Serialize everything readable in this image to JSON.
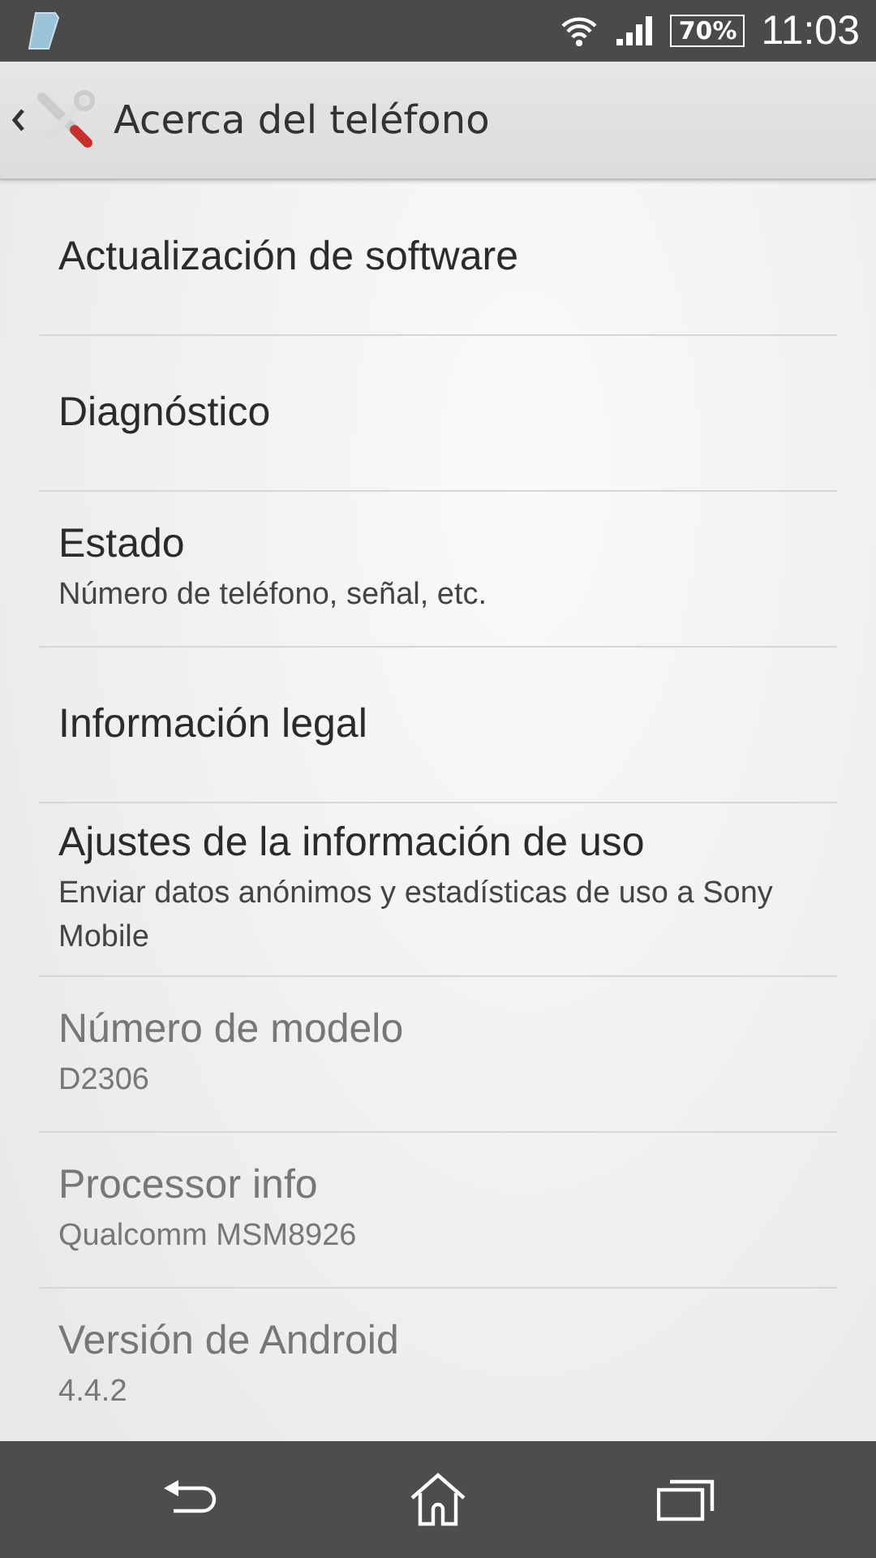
{
  "status_bar": {
    "battery": "70%",
    "time": "11:03"
  },
  "header": {
    "title": "Acerca del teléfono"
  },
  "items": [
    {
      "title": "Actualización de software",
      "disabled": false
    },
    {
      "title": "Diagnóstico",
      "disabled": false
    },
    {
      "title": "Estado",
      "summary": "Número de teléfono, señal, etc.",
      "disabled": false
    },
    {
      "title": "Información legal",
      "disabled": false
    },
    {
      "title": "Ajustes de la información de uso",
      "summary": "Enviar datos anónimos y estadísticas de uso a Sony Mobile",
      "disabled": false
    },
    {
      "title": "Número de modelo",
      "summary": "D2306",
      "disabled": true
    },
    {
      "title": "Processor info",
      "summary": "Qualcomm MSM8926",
      "disabled": true
    },
    {
      "title": "Versión de Android",
      "summary": "4.4.2",
      "disabled": true
    }
  ]
}
